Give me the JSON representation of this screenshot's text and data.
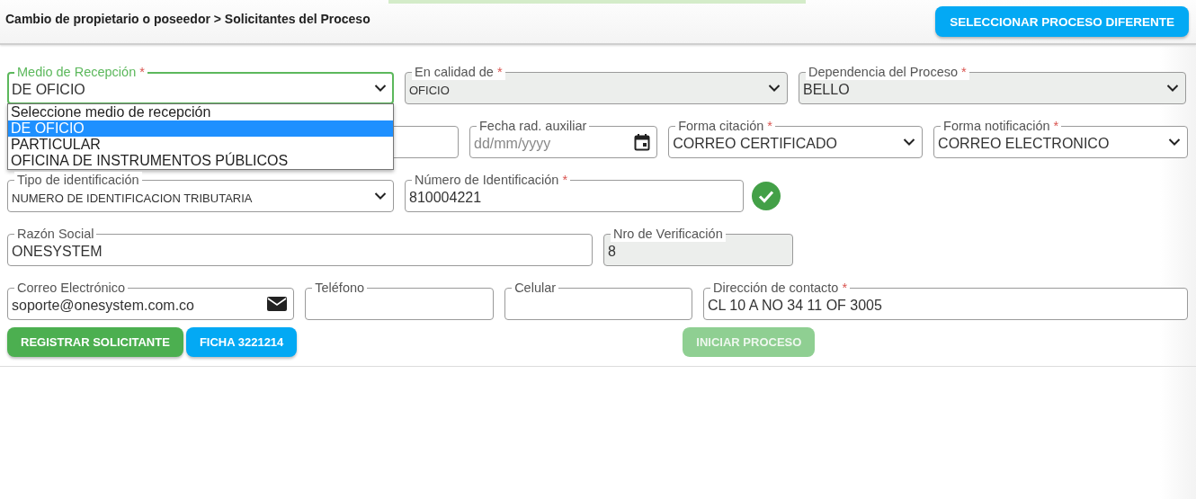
{
  "header": {
    "breadcrumb": "Cambio de propietario o poseedor > Solicitantes del Proceso",
    "button": "SELECCIONAR PROCESO DIFERENTE"
  },
  "rows": [
    {
      "fields": [
        {
          "kind": "select",
          "label": "Medio de Recepción",
          "required_mark": "*",
          "value": "DE OFICIO",
          "focused": true,
          "disabled": false
        },
        {
          "kind": "select",
          "label": "En calidad de",
          "required_mark": "*",
          "value": "OFICIO",
          "small": true,
          "focused": false,
          "disabled": true
        },
        {
          "kind": "select",
          "label": "Dependencia del Proceso",
          "required_mark": "*",
          "value": "BELLO",
          "focused": false,
          "disabled": true
        }
      ]
    },
    {
      "fields": [
        {
          "kind": "input",
          "focused": false,
          "disabled": false
        },
        {
          "kind": "date",
          "label": "Fecha rad. auxiliar",
          "placeholder": "dd/mm/yyyy",
          "focused": false,
          "disabled": false
        },
        {
          "kind": "select",
          "label": "Forma citación",
          "required_mark": "*",
          "value": "CORREO CERTIFICADO",
          "focused": false,
          "disabled": false
        },
        {
          "kind": "select",
          "label": "Forma notificación",
          "required_mark": "*",
          "value": "CORREO ELECTRONICO",
          "focused": false,
          "disabled": false
        }
      ]
    },
    {
      "fields": [
        {
          "kind": "select",
          "label": "Tipo de identificación",
          "value": "NUMERO DE IDENTIFICACION TRIBUTARIA",
          "small": true,
          "focused": false,
          "disabled": false
        },
        {
          "kind": "input",
          "label": "Número de Identificación",
          "required_mark": "*",
          "value": "810004221",
          "focused": false,
          "disabled": false
        },
        {
          "kind": "check"
        }
      ]
    },
    {
      "fields": [
        {
          "kind": "input",
          "label": "Razón Social",
          "value": "ONESYSTEM",
          "focused": false,
          "disabled": false
        },
        {
          "kind": "input",
          "label": "Nro de Verificación",
          "value": "8",
          "focused": false,
          "disabled": true
        }
      ]
    },
    {
      "fields": [
        {
          "kind": "email",
          "label": "Correo Electrónico",
          "value": "soporte@onesystem.com.co",
          "focused": false,
          "disabled": false
        },
        {
          "kind": "input",
          "label": "Teléfono",
          "focused": false,
          "disabled": false
        },
        {
          "kind": "input",
          "label": "Celular",
          "focused": false,
          "disabled": false
        },
        {
          "kind": "input",
          "label": "Dirección de contacto",
          "required_mark": "*",
          "value": "CL 10 A NO 34 11 OF 3005",
          "focused": false,
          "disabled": false
        }
      ]
    }
  ],
  "dropdown": [
    {
      "label": "Seleccione medio de recepción",
      "selected": false
    },
    {
      "label": "DE OFICIO",
      "selected": true
    },
    {
      "label": "PARTICULAR",
      "selected": false
    },
    {
      "label": "OFICINA DE INSTRUMENTOS PÚBLICOS",
      "selected": false
    }
  ],
  "buttons": [
    {
      "label": "REGISTRAR SOLICITANTE",
      "color": "#4caf50",
      "disabled": false
    },
    {
      "label": "FICHA 3221214",
      "color": "#03a9f4",
      "disabled": false
    },
    {
      "label": "INICIAR PROCESO",
      "color": "#8fcf92",
      "disabled": true
    }
  ]
}
